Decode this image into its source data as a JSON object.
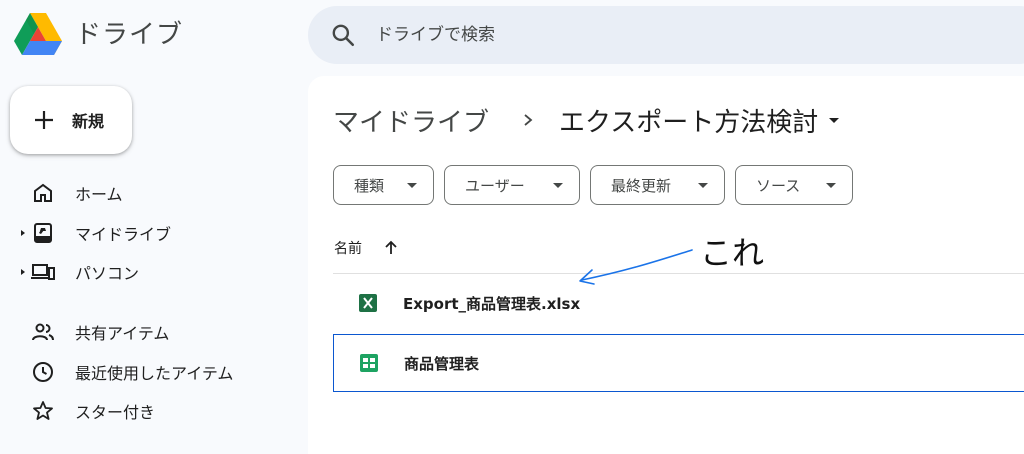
{
  "app": {
    "title": "ドライブ"
  },
  "search": {
    "placeholder": "ドライブで検索"
  },
  "new_button": {
    "label": "新規"
  },
  "sidebar": {
    "items": [
      {
        "label": "ホーム",
        "icon": "home-icon"
      },
      {
        "label": "マイドライブ",
        "icon": "my-drive-icon"
      },
      {
        "label": "パソコン",
        "icon": "computer-icon"
      },
      {
        "label": "共有アイテム",
        "icon": "people-icon"
      },
      {
        "label": "最近使用したアイテム",
        "icon": "clock-icon"
      },
      {
        "label": "スター付き",
        "icon": "star-icon"
      }
    ]
  },
  "breadcrumb": {
    "parent": "マイドライブ",
    "current": "エクスポート方法検討"
  },
  "filters": [
    {
      "label": "種類"
    },
    {
      "label": "ユーザー"
    },
    {
      "label": "最終更新"
    },
    {
      "label": "ソース"
    }
  ],
  "file_list": {
    "column_name": "名前",
    "files": [
      {
        "name": "Export_商品管理表.xlsx",
        "icon": "excel-icon"
      },
      {
        "name": "商品管理表",
        "icon": "sheets-icon"
      }
    ]
  },
  "annotation": {
    "text": "これ"
  },
  "colors": {
    "excel_green": "#1e7145",
    "sheets_green": "#1ea362",
    "selection_blue": "#0b57d0",
    "arrow_blue": "#1a73e8"
  }
}
